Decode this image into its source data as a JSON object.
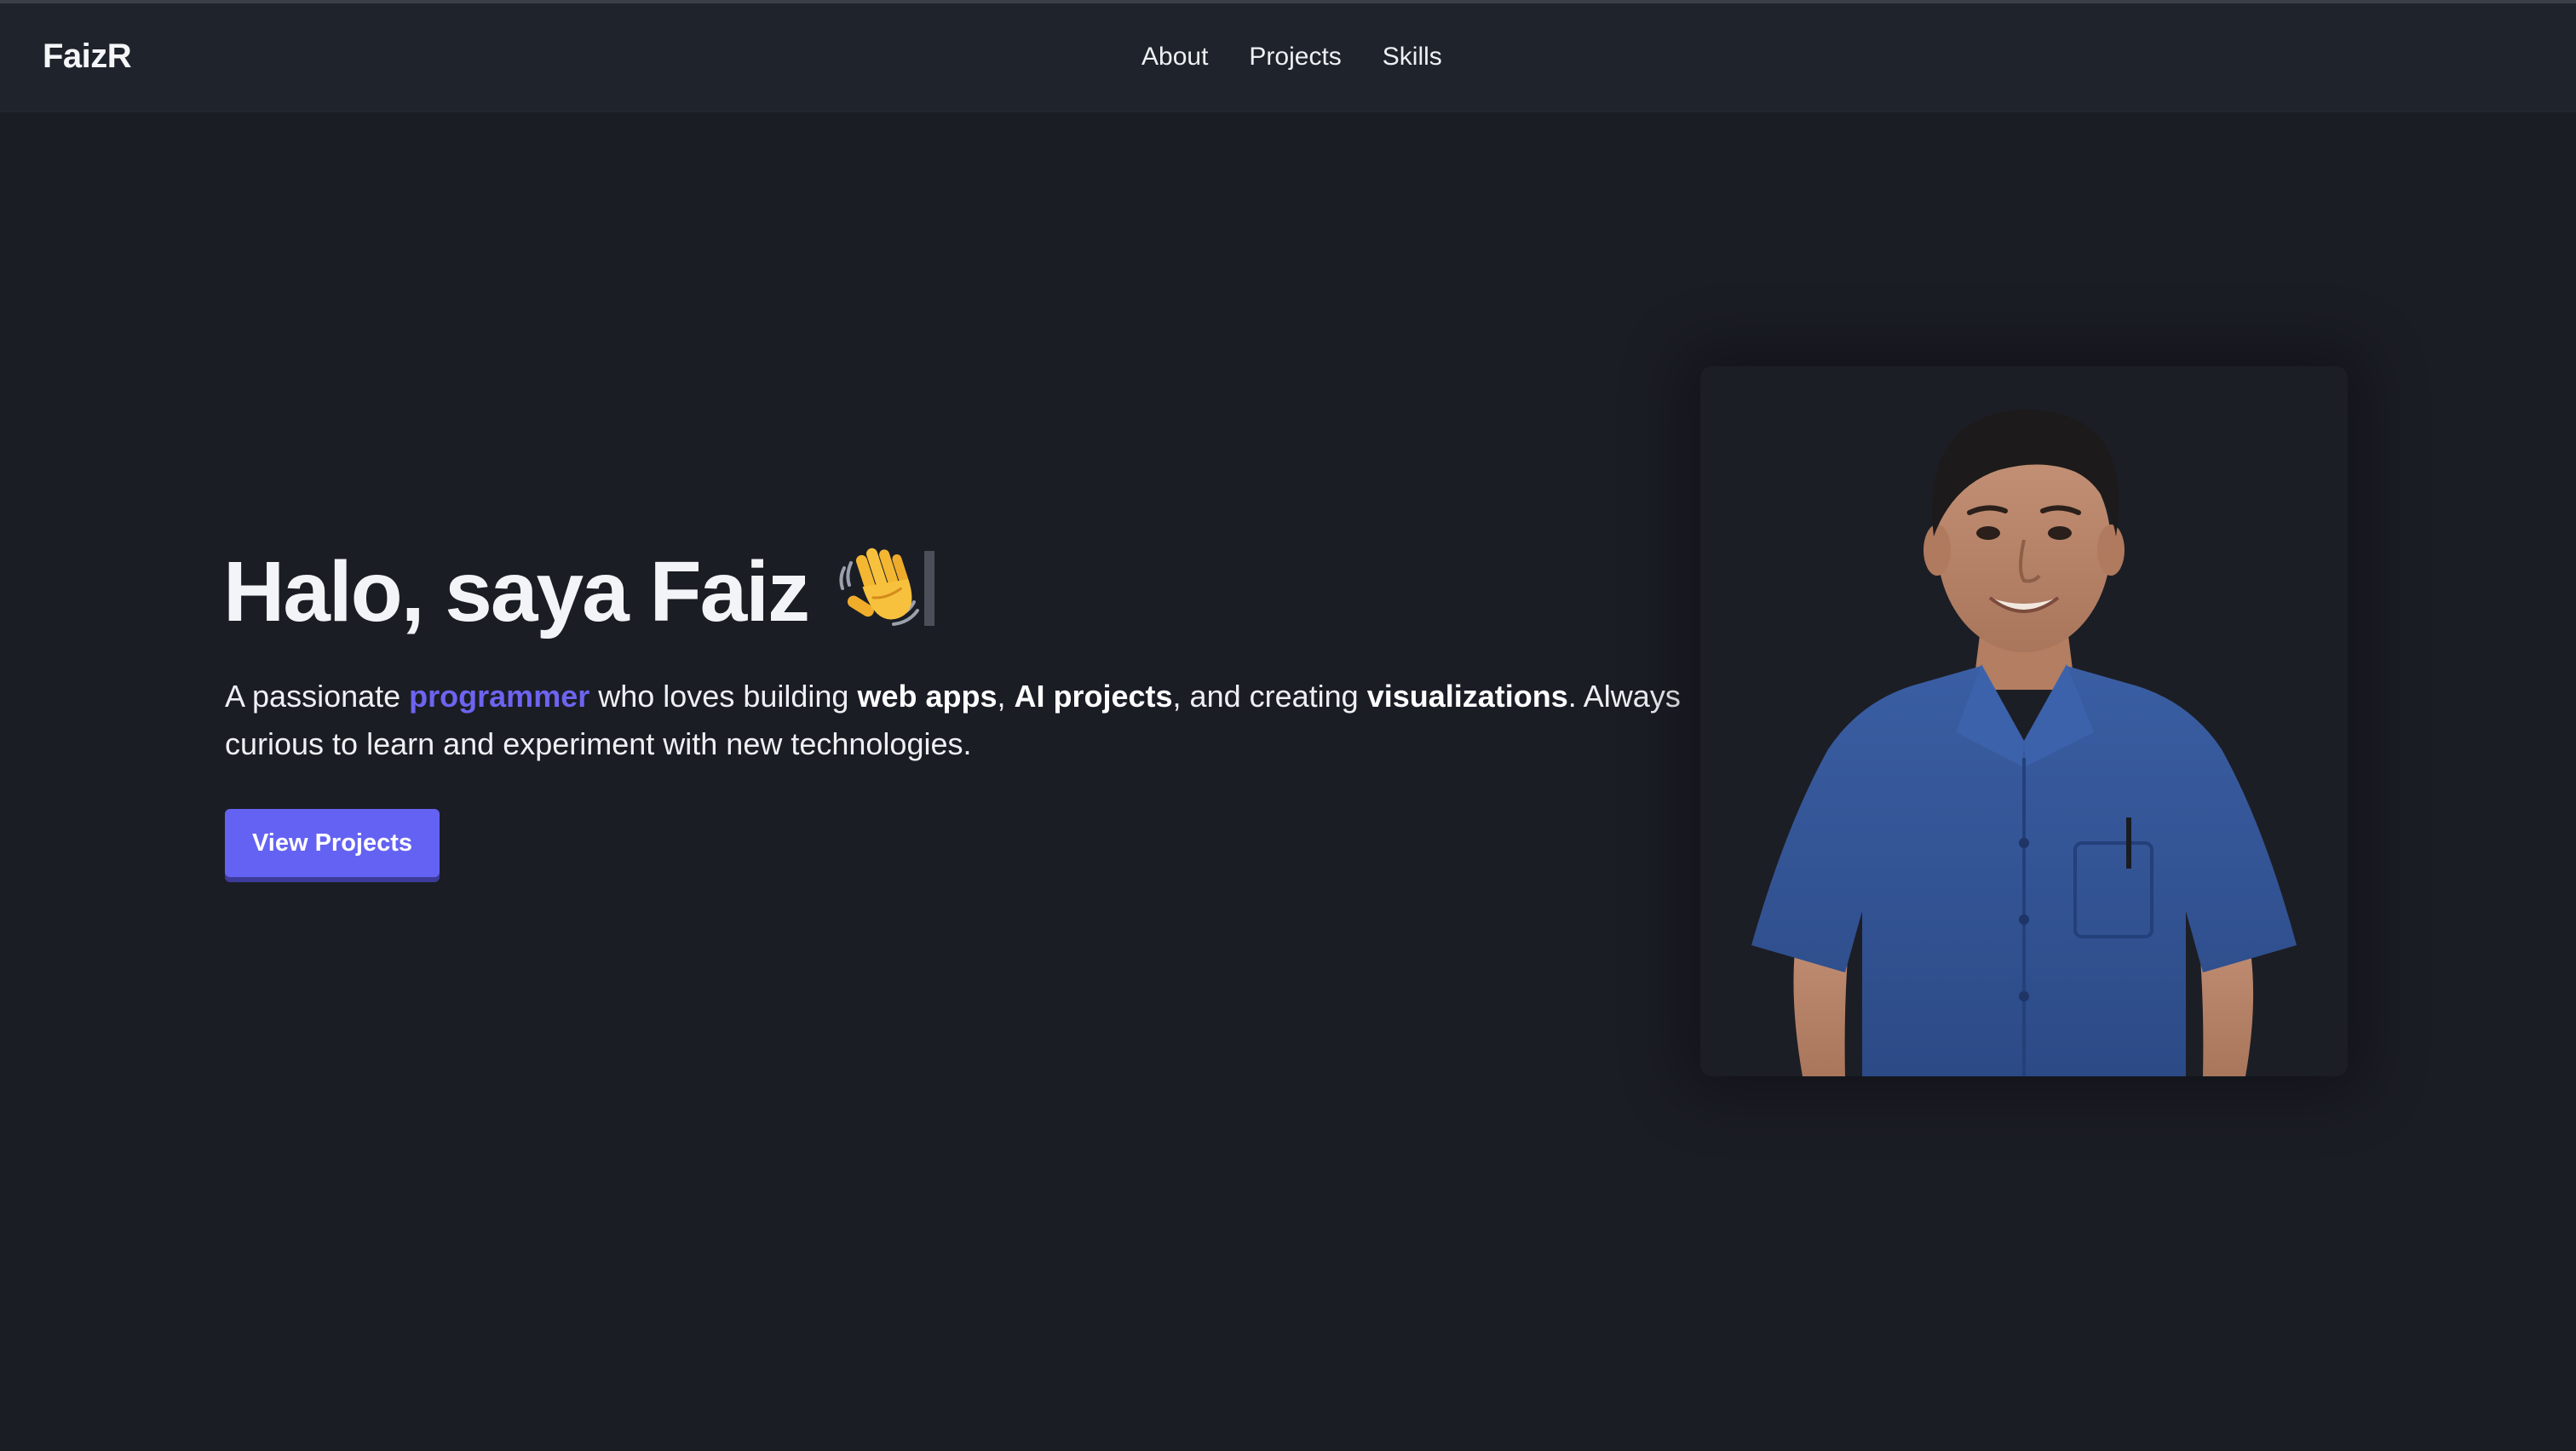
{
  "header": {
    "brand": "FaizR",
    "nav": [
      {
        "label": "About"
      },
      {
        "label": "Projects"
      },
      {
        "label": "Skills"
      }
    ]
  },
  "hero": {
    "title": "Halo, saya Faiz",
    "wave_icon": "waving-hand-icon",
    "desc": {
      "t1": "A passionate ",
      "highlight": "programmer",
      "t2": " who loves building ",
      "b1": "web apps",
      "t3": ", ",
      "b2": "AI projects",
      "t4": ", and creating ",
      "b3": "visualizations",
      "t5": ". Always curious to learn and experiment with new technologies."
    },
    "cta_label": "View Projects"
  },
  "colors": {
    "background": "#1b1d25",
    "navbar": "#1f232b",
    "accent": "#6462f2",
    "highlight_text": "#6d64f0",
    "text": "#f1f3f6"
  }
}
